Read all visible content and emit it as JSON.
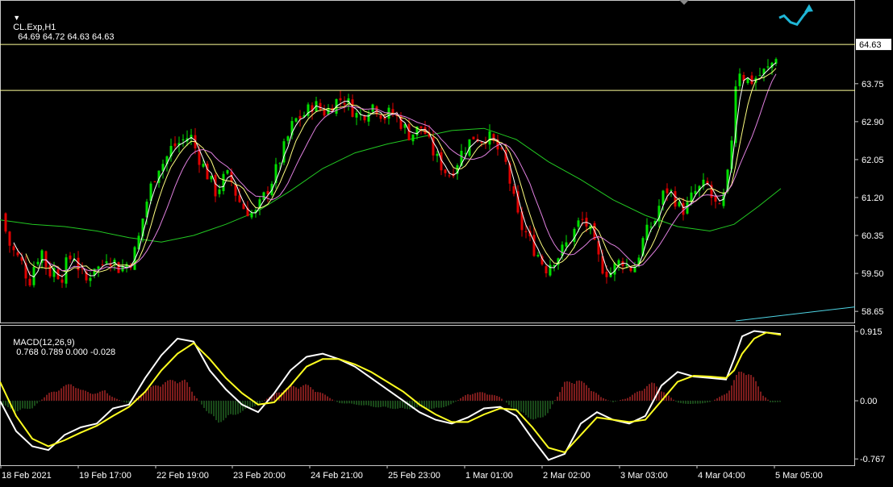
{
  "header": {
    "symbol_label": "CL.Exp,H1",
    "ohlc_label": "64.69 64.72 64.63 64.63",
    "menu_icon": "triangle-down-icon"
  },
  "macd_header": {
    "label": "MACD(12,26,9)",
    "values_label": "0.768 0.789 0.000 -0.028"
  },
  "price_tag": "64.63",
  "colors": {
    "background": "#000000",
    "frame": "#c8c8c8",
    "bull_candle": "#00e000",
    "bear_candle": "#e00000",
    "ma_fast": "#ffffff",
    "ma_mid": "#ffff80",
    "ma_slow": "#e080e0",
    "ma_long": "#22c822",
    "hline": "#ffff99",
    "trendline": "#4fd6e6",
    "arrow": "#1fb6d6",
    "macd_line": "#ffffff",
    "signal_line": "#ffff20",
    "hist_pos": "#d03030",
    "hist_neg": "#2a7a2a"
  },
  "chart_data": [
    {
      "type": "candlestick",
      "name": "price",
      "y_ticks": [
        "64.63",
        "63.75",
        "62.90",
        "62.05",
        "61.20",
        "60.35",
        "59.50",
        "58.65"
      ],
      "ylim": [
        58.4,
        65.3
      ],
      "x_ticks": [
        "18 Feb 2021",
        "19 Feb 17:00",
        "22 Feb 19:00",
        "23 Feb 20:00",
        "24 Feb 21:00",
        "25 Feb 23:00",
        "1 Mar 01:00",
        "2 Mar 02:00",
        "3 Mar 03:00",
        "4 Mar 04:00",
        "5 Mar 05:00"
      ],
      "horizontal_lines": [
        64.63,
        63.6
      ],
      "close_path": [
        [
          0,
          61.0
        ],
        [
          10,
          60.2
        ],
        [
          20,
          59.9
        ],
        [
          28,
          59.7
        ],
        [
          36,
          59.3
        ],
        [
          44,
          59.8
        ],
        [
          52,
          60.0
        ],
        [
          60,
          59.5
        ],
        [
          68,
          59.6
        ],
        [
          76,
          59.4
        ],
        [
          84,
          59.8
        ],
        [
          92,
          59.9
        ],
        [
          100,
          59.5
        ],
        [
          108,
          59.3
        ],
        [
          116,
          59.7
        ],
        [
          124,
          59.6
        ],
        [
          132,
          59.9
        ],
        [
          140,
          59.8
        ],
        [
          148,
          59.6
        ],
        [
          156,
          59.7
        ],
        [
          164,
          59.8
        ],
        [
          172,
          60.3
        ],
        [
          180,
          61.0
        ],
        [
          188,
          61.5
        ],
        [
          196,
          61.9
        ],
        [
          204,
          62.0
        ],
        [
          212,
          62.3
        ],
        [
          220,
          62.4
        ],
        [
          228,
          62.5
        ],
        [
          236,
          62.6
        ],
        [
          244,
          62.2
        ],
        [
          252,
          61.9
        ],
        [
          260,
          61.6
        ],
        [
          268,
          61.3
        ],
        [
          276,
          61.6
        ],
        [
          284,
          61.7
        ],
        [
          292,
          61.3
        ],
        [
          300,
          61.0
        ],
        [
          308,
          60.9
        ],
        [
          316,
          60.8
        ],
        [
          324,
          61.1
        ],
        [
          332,
          61.4
        ],
        [
          340,
          61.7
        ],
        [
          348,
          62.1
        ],
        [
          356,
          62.5
        ],
        [
          364,
          62.9
        ],
        [
          372,
          63.0
        ],
        [
          380,
          63.1
        ],
        [
          388,
          63.3
        ],
        [
          396,
          63.2
        ],
        [
          404,
          63.1
        ],
        [
          412,
          63.3
        ],
        [
          420,
          63.4
        ],
        [
          428,
          63.4
        ],
        [
          436,
          63.2
        ],
        [
          444,
          63.0
        ],
        [
          452,
          63.1
        ],
        [
          460,
          63.3
        ],
        [
          468,
          63.2
        ],
        [
          476,
          63.0
        ],
        [
          484,
          63.1
        ],
        [
          492,
          63.0
        ],
        [
          500,
          62.8
        ],
        [
          508,
          62.6
        ],
        [
          516,
          62.7
        ],
        [
          524,
          62.8
        ],
        [
          532,
          62.4
        ],
        [
          540,
          62.1
        ],
        [
          548,
          61.9
        ],
        [
          556,
          61.7
        ],
        [
          564,
          61.9
        ],
        [
          572,
          62.2
        ],
        [
          580,
          62.4
        ],
        [
          588,
          62.6
        ],
        [
          596,
          62.5
        ],
        [
          604,
          62.6
        ],
        [
          612,
          62.4
        ],
        [
          620,
          62.2
        ],
        [
          628,
          61.9
        ],
        [
          636,
          61.2
        ],
        [
          644,
          60.6
        ],
        [
          652,
          60.4
        ],
        [
          660,
          60.1
        ],
        [
          668,
          59.9
        ],
        [
          676,
          59.6
        ],
        [
          684,
          59.8
        ],
        [
          692,
          59.9
        ],
        [
          700,
          60.1
        ],
        [
          708,
          60.3
        ],
        [
          716,
          60.6
        ],
        [
          724,
          60.7
        ],
        [
          732,
          60.4
        ],
        [
          740,
          59.9
        ],
        [
          748,
          59.6
        ],
        [
          756,
          59.5
        ],
        [
          764,
          59.7
        ],
        [
          772,
          59.8
        ],
        [
          780,
          59.6
        ],
        [
          788,
          59.7
        ],
        [
          796,
          60.2
        ],
        [
          804,
          60.5
        ],
        [
          812,
          60.7
        ],
        [
          820,
          61.2
        ],
        [
          828,
          61.4
        ],
        [
          836,
          61.2
        ],
        [
          844,
          60.9
        ],
        [
          852,
          61.0
        ],
        [
          860,
          61.3
        ],
        [
          868,
          61.4
        ],
        [
          876,
          61.5
        ],
        [
          884,
          61.1
        ],
        [
          892,
          60.9
        ],
        [
          900,
          61.4
        ],
        [
          906,
          62.2
        ],
        [
          910,
          63.6
        ],
        [
          916,
          64.1
        ],
        [
          922,
          63.9
        ],
        [
          930,
          63.8
        ],
        [
          938,
          63.9
        ],
        [
          946,
          64.0
        ],
        [
          954,
          64.1
        ],
        [
          962,
          64.4
        ],
        [
          966,
          64.63
        ]
      ],
      "ma_long_path": [
        [
          0,
          60.7
        ],
        [
          40,
          60.6
        ],
        [
          80,
          60.55
        ],
        [
          120,
          60.45
        ],
        [
          160,
          60.3
        ],
        [
          200,
          60.2
        ],
        [
          240,
          60.35
        ],
        [
          280,
          60.6
        ],
        [
          320,
          60.9
        ],
        [
          360,
          61.35
        ],
        [
          400,
          61.85
        ],
        [
          440,
          62.2
        ],
        [
          480,
          62.4
        ],
        [
          520,
          62.55
        ],
        [
          560,
          62.7
        ],
        [
          600,
          62.75
        ],
        [
          640,
          62.5
        ],
        [
          680,
          62.0
        ],
        [
          720,
          61.6
        ],
        [
          760,
          61.15
        ],
        [
          800,
          60.8
        ],
        [
          840,
          60.55
        ],
        [
          880,
          60.45
        ],
        [
          910,
          60.6
        ],
        [
          940,
          61.0
        ],
        [
          968,
          61.4
        ]
      ],
      "trendline": [
        [
          912,
          58.4
        ],
        [
          1060,
          58.75
        ]
      ],
      "arrow_path": [
        [
          966,
          64.9
        ],
        [
          972,
          64.95
        ],
        [
          980,
          64.8
        ],
        [
          988,
          64.75
        ],
        [
          996,
          64.95
        ],
        [
          1003,
          65.1
        ]
      ]
    },
    {
      "type": "macd",
      "name": "MACD(12,26,9)",
      "y_ticks": [
        "0.915",
        "0.00",
        "-0.767"
      ],
      "ylim": [
        -0.85,
        1.0
      ],
      "macd_path": [
        [
          0,
          0.0
        ],
        [
          20,
          -0.4
        ],
        [
          40,
          -0.6
        ],
        [
          60,
          -0.65
        ],
        [
          80,
          -0.45
        ],
        [
          100,
          -0.35
        ],
        [
          120,
          -0.3
        ],
        [
          140,
          -0.1
        ],
        [
          160,
          -0.05
        ],
        [
          180,
          0.3
        ],
        [
          200,
          0.6
        ],
        [
          220,
          0.82
        ],
        [
          240,
          0.78
        ],
        [
          260,
          0.4
        ],
        [
          280,
          0.15
        ],
        [
          300,
          -0.05
        ],
        [
          320,
          -0.15
        ],
        [
          340,
          0.1
        ],
        [
          360,
          0.4
        ],
        [
          380,
          0.58
        ],
        [
          400,
          0.62
        ],
        [
          420,
          0.55
        ],
        [
          440,
          0.45
        ],
        [
          460,
          0.3
        ],
        [
          480,
          0.15
        ],
        [
          500,
          0.0
        ],
        [
          520,
          -0.15
        ],
        [
          540,
          -0.25
        ],
        [
          560,
          -0.3
        ],
        [
          580,
          -0.22
        ],
        [
          600,
          -0.1
        ],
        [
          620,
          -0.08
        ],
        [
          640,
          -0.2
        ],
        [
          660,
          -0.5
        ],
        [
          680,
          -0.78
        ],
        [
          700,
          -0.7
        ],
        [
          720,
          -0.3
        ],
        [
          740,
          -0.15
        ],
        [
          760,
          -0.25
        ],
        [
          780,
          -0.3
        ],
        [
          800,
          -0.2
        ],
        [
          820,
          0.2
        ],
        [
          840,
          0.38
        ],
        [
          860,
          0.32
        ],
        [
          880,
          0.3
        ],
        [
          900,
          0.28
        ],
        [
          910,
          0.55
        ],
        [
          920,
          0.85
        ],
        [
          935,
          0.92
        ],
        [
          950,
          0.9
        ],
        [
          968,
          0.88
        ]
      ],
      "signal_path": [
        [
          0,
          0.25
        ],
        [
          20,
          -0.2
        ],
        [
          40,
          -0.5
        ],
        [
          60,
          -0.6
        ],
        [
          80,
          -0.52
        ],
        [
          100,
          -0.42
        ],
        [
          120,
          -0.33
        ],
        [
          140,
          -0.2
        ],
        [
          160,
          -0.08
        ],
        [
          180,
          0.12
        ],
        [
          200,
          0.4
        ],
        [
          220,
          0.62
        ],
        [
          240,
          0.76
        ],
        [
          260,
          0.55
        ],
        [
          280,
          0.3
        ],
        [
          300,
          0.1
        ],
        [
          320,
          -0.05
        ],
        [
          340,
          -0.02
        ],
        [
          360,
          0.2
        ],
        [
          380,
          0.45
        ],
        [
          400,
          0.55
        ],
        [
          420,
          0.55
        ],
        [
          440,
          0.48
        ],
        [
          460,
          0.38
        ],
        [
          480,
          0.25
        ],
        [
          500,
          0.12
        ],
        [
          520,
          -0.05
        ],
        [
          540,
          -0.18
        ],
        [
          560,
          -0.28
        ],
        [
          580,
          -0.28
        ],
        [
          600,
          -0.18
        ],
        [
          620,
          -0.1
        ],
        [
          640,
          -0.12
        ],
        [
          660,
          -0.35
        ],
        [
          680,
          -0.62
        ],
        [
          700,
          -0.68
        ],
        [
          720,
          -0.45
        ],
        [
          740,
          -0.22
        ],
        [
          760,
          -0.25
        ],
        [
          780,
          -0.28
        ],
        [
          800,
          -0.25
        ],
        [
          820,
          0.0
        ],
        [
          840,
          0.25
        ],
        [
          860,
          0.33
        ],
        [
          880,
          0.32
        ],
        [
          900,
          0.3
        ],
        [
          910,
          0.4
        ],
        [
          920,
          0.62
        ],
        [
          935,
          0.82
        ],
        [
          950,
          0.9
        ],
        [
          968,
          0.87
        ]
      ],
      "hist_path": [
        [
          0,
          -0.05
        ],
        [
          20,
          -0.15
        ],
        [
          40,
          -0.1
        ],
        [
          60,
          0.1
        ],
        [
          80,
          0.2
        ],
        [
          90,
          0.25
        ],
        [
          100,
          0.15
        ],
        [
          120,
          0.1
        ],
        [
          130,
          0.15
        ],
        [
          140,
          0.05
        ],
        [
          160,
          -0.05
        ],
        [
          180,
          0.15
        ],
        [
          200,
          0.25
        ],
        [
          220,
          0.3
        ],
        [
          230,
          0.28
        ],
        [
          240,
          0.1
        ],
        [
          260,
          -0.2
        ],
        [
          270,
          -0.3
        ],
        [
          280,
          -0.25
        ],
        [
          300,
          -0.15
        ],
        [
          320,
          -0.05
        ],
        [
          340,
          0.1
        ],
        [
          360,
          0.2
        ],
        [
          380,
          0.22
        ],
        [
          400,
          0.1
        ],
        [
          420,
          -0.03
        ],
        [
          440,
          -0.05
        ],
        [
          460,
          -0.08
        ],
        [
          480,
          -0.1
        ],
        [
          500,
          -0.12
        ],
        [
          520,
          -0.1
        ],
        [
          540,
          -0.12
        ],
        [
          560,
          -0.05
        ],
        [
          580,
          0.1
        ],
        [
          600,
          0.12
        ],
        [
          620,
          0.05
        ],
        [
          640,
          -0.15
        ],
        [
          660,
          -0.25
        ],
        [
          670,
          -0.28
        ],
        [
          680,
          -0.15
        ],
        [
          700,
          0.25
        ],
        [
          715,
          0.3
        ],
        [
          730,
          0.2
        ],
        [
          745,
          0.05
        ],
        [
          760,
          -0.02
        ],
        [
          780,
          0.05
        ],
        [
          800,
          0.2
        ],
        [
          810,
          0.25
        ],
        [
          820,
          0.15
        ],
        [
          840,
          -0.03
        ],
        [
          860,
          -0.05
        ],
        [
          880,
          -0.02
        ],
        [
          900,
          0.1
        ],
        [
          915,
          0.38
        ],
        [
          925,
          0.45
        ],
        [
          935,
          0.3
        ],
        [
          945,
          0.1
        ],
        [
          955,
          -0.02
        ],
        [
          968,
          -0.02
        ]
      ]
    }
  ]
}
